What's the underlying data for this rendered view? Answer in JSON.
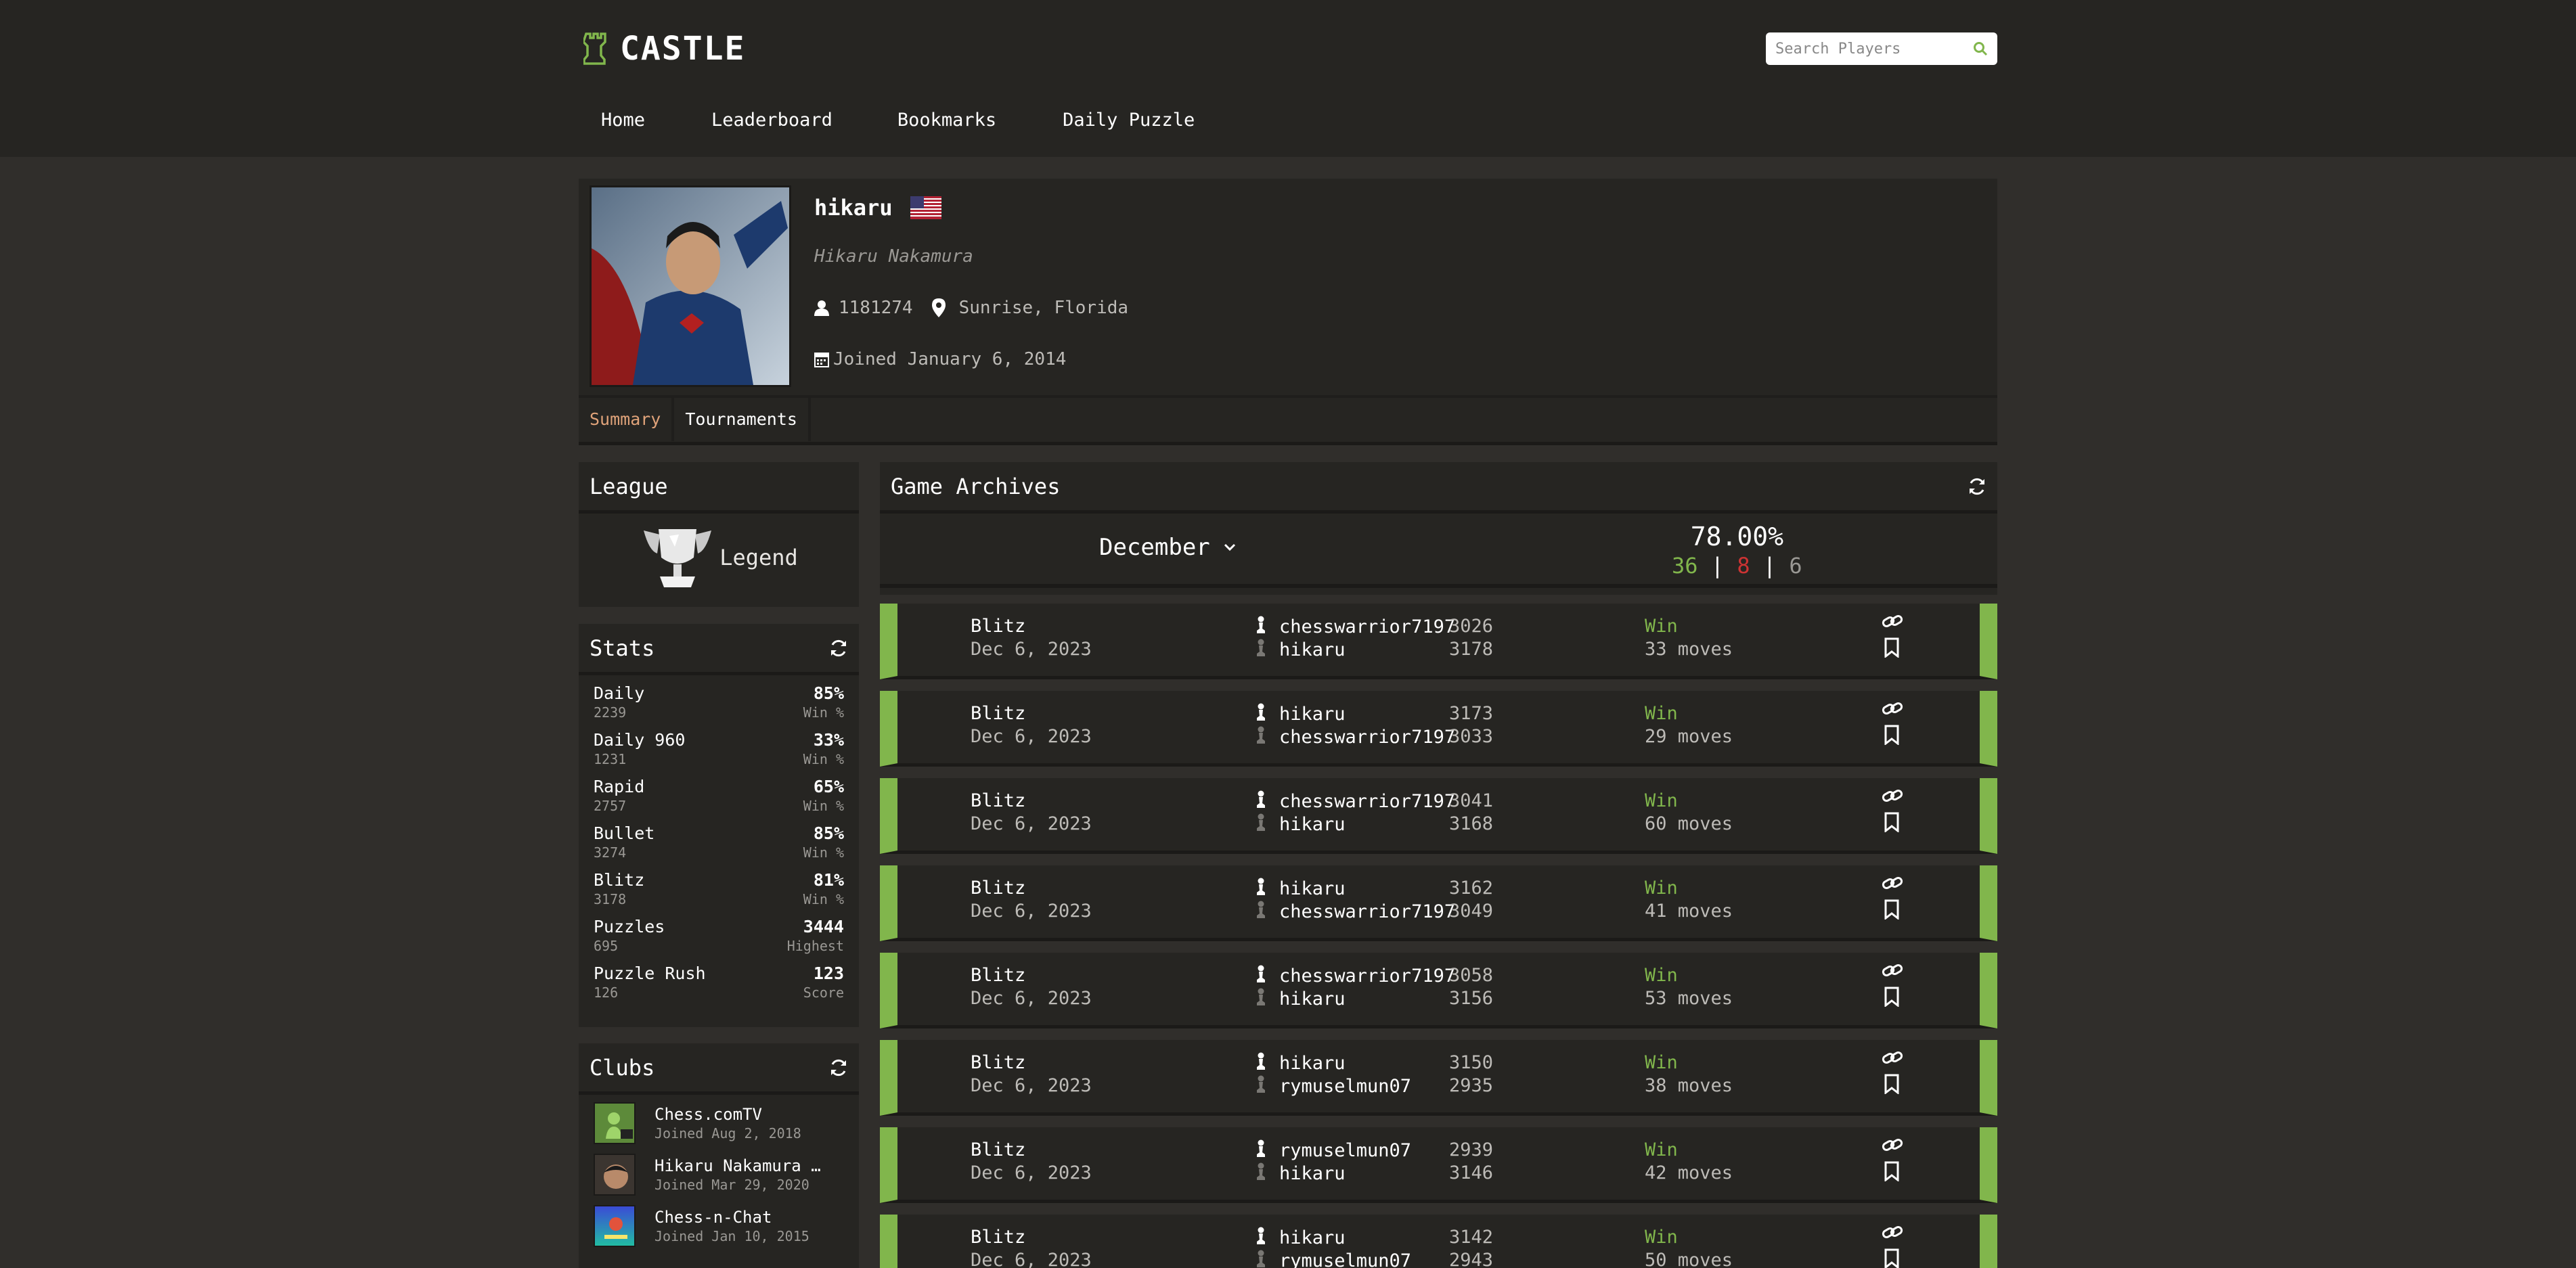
{
  "brand": {
    "name": "CASTLE",
    "accent": "#81b64c"
  },
  "search": {
    "placeholder": "Search Players"
  },
  "nav": [
    "Home",
    "Leaderboard",
    "Bookmarks",
    "Daily Puzzle"
  ],
  "profile": {
    "username": "hikaru",
    "country_flag": "us-flag-icon",
    "full_name": "Hikaru Nakamura",
    "followers": "1181274",
    "location": "Sunrise, Florida",
    "joined": "Joined January 6, 2014",
    "tabs": [
      "Summary",
      "Tournaments"
    ]
  },
  "league": {
    "title": "League",
    "name": "Legend"
  },
  "stats": {
    "title": "Stats",
    "rows": [
      {
        "name": "Daily",
        "rating": "2239",
        "value": "85%",
        "label": "Win %"
      },
      {
        "name": "Daily 960",
        "rating": "1231",
        "value": "33%",
        "label": "Win %"
      },
      {
        "name": "Rapid",
        "rating": "2757",
        "value": "65%",
        "label": "Win %"
      },
      {
        "name": "Bullet",
        "rating": "3274",
        "value": "85%",
        "label": "Win %"
      },
      {
        "name": "Blitz",
        "rating": "3178",
        "value": "81%",
        "label": "Win %"
      },
      {
        "name": "Puzzles",
        "rating": "695",
        "value": "3444",
        "label": "Highest"
      },
      {
        "name": "Puzzle Rush",
        "rating": "126",
        "value": "123",
        "label": "Score"
      }
    ]
  },
  "clubs": {
    "title": "Clubs",
    "items": [
      {
        "name": "Chess.comTV",
        "joined": "Joined Aug 2, 2018"
      },
      {
        "name": "Hikaru Nakamura …",
        "joined": "Joined Mar 29, 2020"
      },
      {
        "name": "Chess-n-Chat",
        "joined": "Joined Jan 10, 2015"
      }
    ]
  },
  "archives": {
    "title": "Game Archives",
    "month": "December",
    "win_pct": "78.00%",
    "wins": "36",
    "losses": "8",
    "draws": "6",
    "separator": "|",
    "games": [
      {
        "type": "Blitz",
        "date": "Dec 6, 2023",
        "white": "chesswarrior7197",
        "white_rating": "3026",
        "black": "hikaru",
        "black_rating": "3178",
        "result": "Win",
        "moves": "33 moves"
      },
      {
        "type": "Blitz",
        "date": "Dec 6, 2023",
        "white": "hikaru",
        "white_rating": "3173",
        "black": "chesswarrior7197",
        "black_rating": "3033",
        "result": "Win",
        "moves": "29 moves"
      },
      {
        "type": "Blitz",
        "date": "Dec 6, 2023",
        "white": "chesswarrior7197",
        "white_rating": "3041",
        "black": "hikaru",
        "black_rating": "3168",
        "result": "Win",
        "moves": "60 moves"
      },
      {
        "type": "Blitz",
        "date": "Dec 6, 2023",
        "white": "hikaru",
        "white_rating": "3162",
        "black": "chesswarrior7197",
        "black_rating": "3049",
        "result": "Win",
        "moves": "41 moves"
      },
      {
        "type": "Blitz",
        "date": "Dec 6, 2023",
        "white": "chesswarrior7197",
        "white_rating": "3058",
        "black": "hikaru",
        "black_rating": "3156",
        "result": "Win",
        "moves": "53 moves"
      },
      {
        "type": "Blitz",
        "date": "Dec 6, 2023",
        "white": "hikaru",
        "white_rating": "3150",
        "black": "rymuselmun07",
        "black_rating": "2935",
        "result": "Win",
        "moves": "38 moves"
      },
      {
        "type": "Blitz",
        "date": "Dec 6, 2023",
        "white": "rymuselmun07",
        "white_rating": "2939",
        "black": "hikaru",
        "black_rating": "3146",
        "result": "Win",
        "moves": "42 moves"
      },
      {
        "type": "Blitz",
        "date": "Dec 6, 2023",
        "white": "hikaru",
        "white_rating": "3142",
        "black": "rymuselmun07",
        "black_rating": "2943",
        "result": "Win",
        "moves": "50 moves"
      }
    ]
  }
}
